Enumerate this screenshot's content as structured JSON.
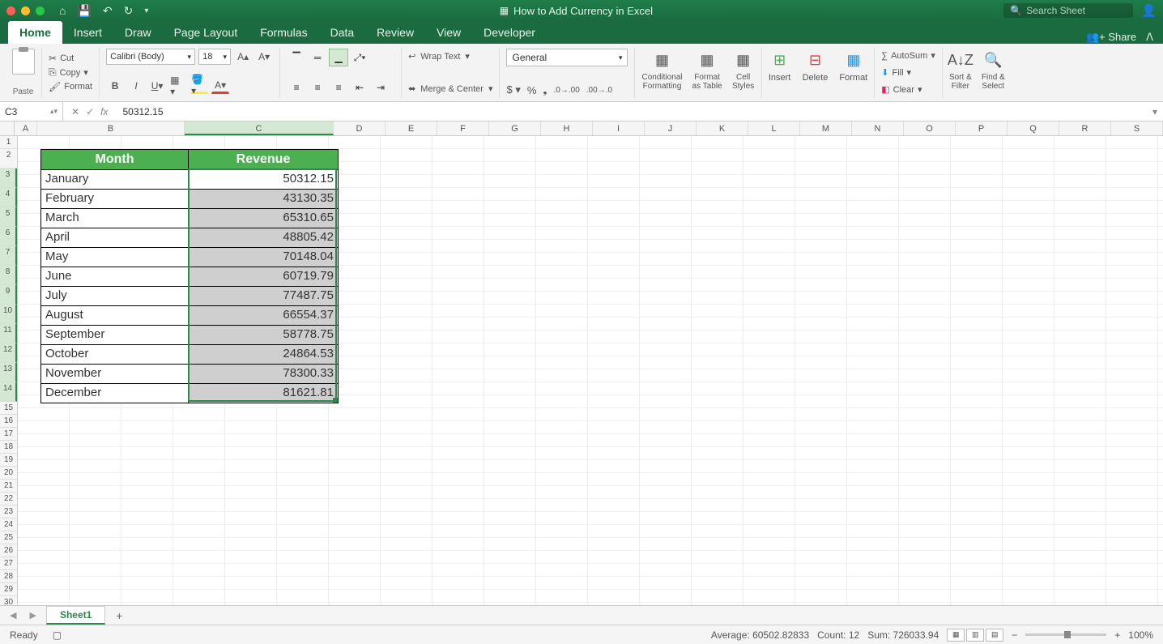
{
  "title": "How to Add Currency in Excel",
  "search_placeholder": "Search Sheet",
  "share_label": "Share",
  "tabs": [
    "Home",
    "Insert",
    "Draw",
    "Page Layout",
    "Formulas",
    "Data",
    "Review",
    "View",
    "Developer"
  ],
  "active_tab": 0,
  "clipboard": {
    "paste": "Paste",
    "cut": "Cut",
    "copy": "Copy",
    "format": "Format"
  },
  "font": {
    "name": "Calibri (Body)",
    "size": "18"
  },
  "wrap": {
    "wrap_text": "Wrap Text",
    "merge_center": "Merge & Center"
  },
  "number": {
    "format": "General"
  },
  "styles": {
    "cond": "Conditional\nFormatting",
    "table": "Format\nas Table",
    "cell": "Cell\nStyles"
  },
  "cells": {
    "insert": "Insert",
    "delete": "Delete",
    "format": "Format"
  },
  "editing": {
    "autosum": "AutoSum",
    "fill": "Fill",
    "clear": "Clear",
    "sort": "Sort &\nFilter",
    "find": "Find &\nSelect"
  },
  "namebox": "C3",
  "formula": "50312.15",
  "columns": [
    "A",
    "B",
    "C",
    "D",
    "E",
    "F",
    "G",
    "H",
    "I",
    "J",
    "K",
    "L",
    "M",
    "N",
    "O",
    "P",
    "Q",
    "R",
    "S"
  ],
  "row_count": 30,
  "table": {
    "headers": [
      "Month",
      "Revenue"
    ],
    "rows": [
      [
        "January",
        "50312.15"
      ],
      [
        "February",
        "43130.35"
      ],
      [
        "March",
        "65310.65"
      ],
      [
        "April",
        "48805.42"
      ],
      [
        "May",
        "70148.04"
      ],
      [
        "June",
        "60719.79"
      ],
      [
        "July",
        "77487.75"
      ],
      [
        "August",
        "66554.37"
      ],
      [
        "September",
        "58778.75"
      ],
      [
        "October",
        "24864.53"
      ],
      [
        "November",
        "78300.33"
      ],
      [
        "December",
        "81621.81"
      ]
    ]
  },
  "sheet_name": "Sheet1",
  "status": {
    "ready": "Ready",
    "average": "Average: 60502.82833",
    "count": "Count: 12",
    "sum": "Sum: 726033.94",
    "zoom": "100%"
  }
}
